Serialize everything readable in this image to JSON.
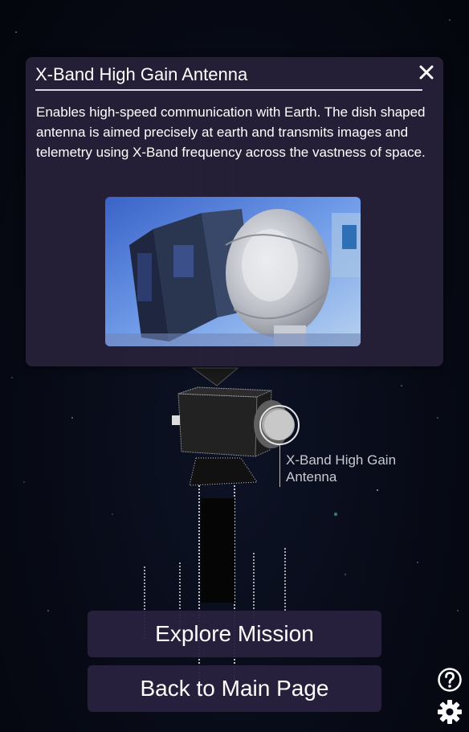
{
  "popup": {
    "title": "X-Band High Gain Antenna",
    "close_icon": "close-icon",
    "description": "Enables high-speed communication with Earth. The dish shaped antenna is aimed precisely at earth and transmits images and telemetry using X-Band frequency across the vastness of space.",
    "image_icon": "satellite-antenna-photo"
  },
  "model": {
    "label_line1": "X-Band High Gain",
    "label_line2": "Antenna"
  },
  "buttons": {
    "explore": "Explore Mission",
    "back": "Back to Main Page"
  },
  "icons": {
    "help": "help-icon",
    "settings": "gear-icon"
  },
  "colors": {
    "panel": "#28203a",
    "button": "#281f3e",
    "background": "#070a15"
  }
}
